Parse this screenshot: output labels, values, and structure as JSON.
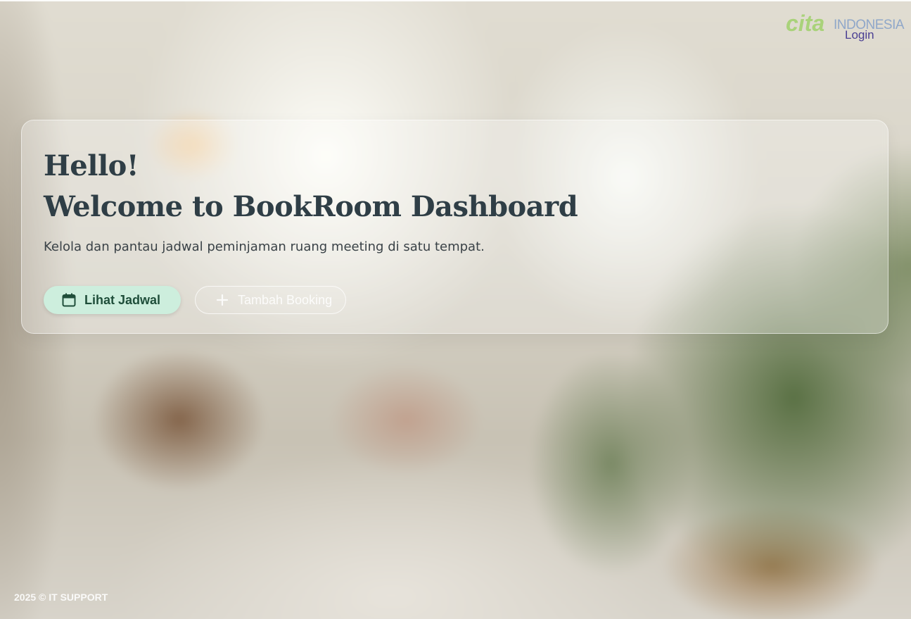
{
  "brand": {
    "logo_primary": "cita",
    "logo_secondary": "INDONESIA",
    "primary_color": "#a9d27a",
    "secondary_color": "#8fa7c9"
  },
  "header": {
    "login_label": "Login"
  },
  "hero": {
    "greeting": "Hello!",
    "title": "Welcome to BookRoom Dashboard",
    "subtitle": "Kelola dan pantau jadwal peminjaman ruang meeting di satu tempat.",
    "primary_button": {
      "label": "Lihat Jadwal",
      "icon": "calendar-icon",
      "color": "#cdeedd"
    },
    "secondary_button": {
      "label": "Tambah Booking",
      "icon": "plus-icon"
    }
  },
  "footer": {
    "text": "2025 © IT SUPPORT"
  }
}
